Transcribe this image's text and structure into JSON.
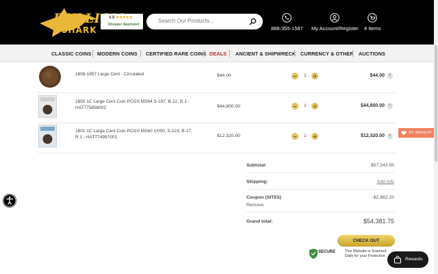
{
  "header": {
    "logo_text": "BULLION",
    "logo_sub": "SHARK",
    "rating_score": "4.8",
    "rating_stars": "★★★★★",
    "rating_badge_prefix": "Shopper",
    "rating_badge_suffix": "Approved",
    "search_placeholder": "Search Our Products...",
    "phone": "888-355-1587",
    "account_label": "My Account/Register",
    "cart_label": "4 Items"
  },
  "nav": {
    "items": [
      {
        "label": "CLASSIC COINS"
      },
      {
        "label": "MODERN COINS"
      },
      {
        "label": "CERTIFIED RARE COINS"
      },
      {
        "label": "DEALS"
      },
      {
        "label": "ANCIENT & SHIPWRECK"
      },
      {
        "label": "CURRENCY & OTHER"
      },
      {
        "label": "AUCTIONS"
      }
    ]
  },
  "cart": {
    "rows": [
      {
        "name": "1808-1857 Large Cent - Circulated",
        "price": "$44.00",
        "qty": "1",
        "total": "$44.00"
      },
      {
        "name": "1800 1C Large Cent Coin PCGS MS64 S-197, B-12, R.1 - HAT775858002",
        "price": "$44,800.00",
        "qty": "1",
        "total": "$44,800.00"
      },
      {
        "name": "1801 1C Large Cent Coin PCGS MS60 1/000, S-223, B-17, R.1 - HAT774997001",
        "price": "$12,320.00",
        "qty": "1",
        "total": "$12,320.00"
      }
    ]
  },
  "summary": {
    "subtotal_label": "Subtotal:",
    "subtotal_value": "$57,243.95",
    "shipping_label": "Shipping:",
    "shipping_value": "Add Info",
    "coupon_label": "Coupon (SITE5)",
    "coupon_value": "-$2,862.20",
    "coupon_remove": "Remove",
    "grand_label": "Grand total:",
    "grand_value": "$54,381.75",
    "checkout_label": "CHECK OUT"
  },
  "badges": {
    "secure_text": "SECURE",
    "scan_line1": "This Website is Scanned",
    "scan_line2": "Daily for your Protection",
    "rewards_label": "Rewards",
    "wishlist_label": "MY WISHLIST"
  },
  "colors": {
    "header_bg": "#000000",
    "brand_gold": "#e9b73a",
    "deals_red": "#c62828",
    "wishlist": "#f08060"
  }
}
